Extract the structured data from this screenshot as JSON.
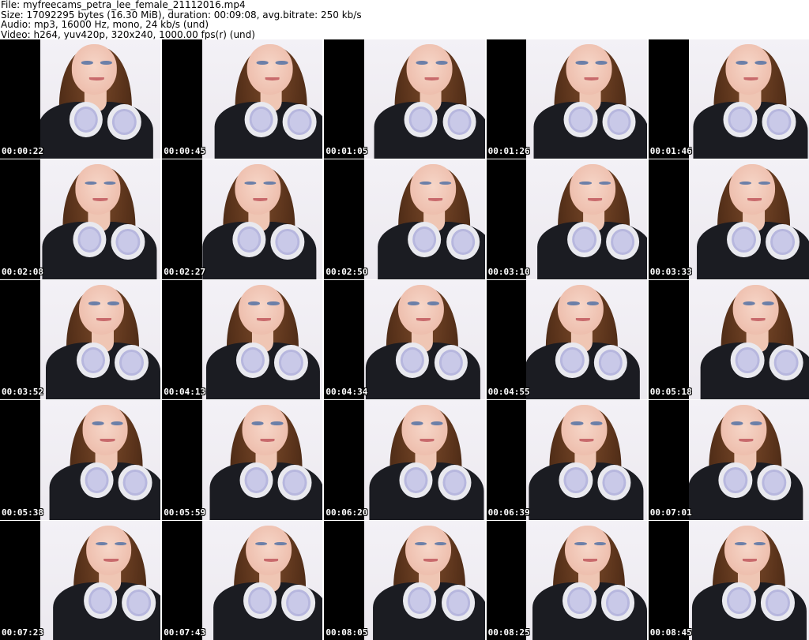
{
  "header": {
    "file_line": "File: myfreecams_petra_lee_female_21112016.mp4",
    "size_line": "Size: 17092295 bytes (16.30 MiB), duration: 00:09:08, avg.bitrate: 250 kb/s",
    "audio_line": "Audio: mp3, 16000 Hz, mono, 24 kb/s (und)",
    "video_line": "Video: h264, yuv420p, 320x240, 1000.00 fps(r) (und)"
  },
  "thumbnails": [
    {
      "timestamp": "00:00:22"
    },
    {
      "timestamp": "00:00:45"
    },
    {
      "timestamp": "00:01:05"
    },
    {
      "timestamp": "00:01:26"
    },
    {
      "timestamp": "00:01:46"
    },
    {
      "timestamp": "00:02:08"
    },
    {
      "timestamp": "00:02:27"
    },
    {
      "timestamp": "00:02:50"
    },
    {
      "timestamp": "00:03:10"
    },
    {
      "timestamp": "00:03:33"
    },
    {
      "timestamp": "00:03:52"
    },
    {
      "timestamp": "00:04:13"
    },
    {
      "timestamp": "00:04:34"
    },
    {
      "timestamp": "00:04:55"
    },
    {
      "timestamp": "00:05:18"
    },
    {
      "timestamp": "00:05:38"
    },
    {
      "timestamp": "00:05:59"
    },
    {
      "timestamp": "00:06:20"
    },
    {
      "timestamp": "00:06:39"
    },
    {
      "timestamp": "00:07:01"
    },
    {
      "timestamp": "00:07:23"
    },
    {
      "timestamp": "00:07:43"
    },
    {
      "timestamp": "00:08:05"
    },
    {
      "timestamp": "00:08:25"
    },
    {
      "timestamp": "00:08:45"
    }
  ]
}
